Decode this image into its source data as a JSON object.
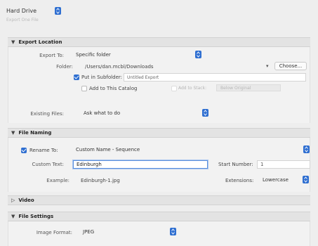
{
  "top": {
    "target": "Hard Drive",
    "subtitle": "Export One File"
  },
  "export_location": {
    "title": "Export Location",
    "export_to_label": "Export To:",
    "export_to_value": "Specific folder",
    "folder_label": "Folder:",
    "folder_path": "/Users/dan.mcbl/Downloads",
    "choose_label": "Choose...",
    "put_in_subfolder_label": "Put in Subfolder:",
    "subfolder_value": "Untitled Export",
    "add_to_catalog_label": "Add to This Catalog",
    "add_to_stack_label": "Add to Stack:",
    "stack_position": "Below Original",
    "existing_files_label": "Existing Files:",
    "existing_files_value": "Ask what to do"
  },
  "file_naming": {
    "title": "File Naming",
    "rename_to_label": "Rename To:",
    "rename_to_value": "Custom Name - Sequence",
    "custom_text_label": "Custom Text:",
    "custom_text_value": "Edinburgh",
    "start_number_label": "Start Number:",
    "start_number_value": "1",
    "example_label": "Example:",
    "example_value": "Edinburgh-1.jpg",
    "extensions_label": "Extensions:",
    "extensions_value": "Lowercase"
  },
  "video": {
    "title": "Video"
  },
  "file_settings": {
    "title": "File Settings",
    "image_format_label": "Image Format:",
    "image_format_value": "JPEG"
  },
  "colors": {
    "accent": "#2f6fd1",
    "header_bg": "#e3e3e3",
    "panel_bg": "#eeeeee"
  },
  "icons": {
    "stepper": "up-down-stepper-icon",
    "disclosure_open": "disclosure-triangle-down-icon",
    "disclosure_closed": "disclosure-triangle-right-icon"
  }
}
